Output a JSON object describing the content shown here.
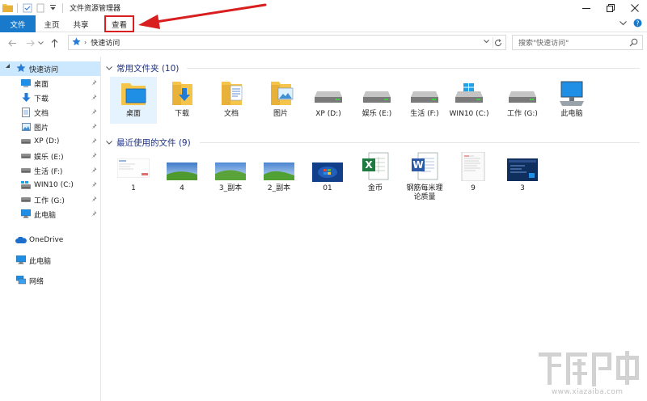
{
  "window": {
    "title": "文件资源管理器"
  },
  "ribbon": {
    "tabs": [
      {
        "label": "文件"
      },
      {
        "label": "主页"
      },
      {
        "label": "共享"
      },
      {
        "label": "查看"
      }
    ]
  },
  "address": {
    "location": "快速访问",
    "search_placeholder": "搜索\"快速访问\""
  },
  "sidebar": {
    "quick_access": "快速访问",
    "items": [
      {
        "label": "桌面",
        "icon": "desktop-icon",
        "pinned": true
      },
      {
        "label": "下载",
        "icon": "download-icon",
        "pinned": true
      },
      {
        "label": "文档",
        "icon": "document-icon",
        "pinned": true
      },
      {
        "label": "图片",
        "icon": "picture-icon",
        "pinned": true
      },
      {
        "label": "XP (D:)",
        "icon": "drive-icon",
        "pinned": true
      },
      {
        "label": "娱乐 (E:)",
        "icon": "drive-icon",
        "pinned": true
      },
      {
        "label": "生活 (F:)",
        "icon": "drive-icon",
        "pinned": true
      },
      {
        "label": "WIN10 (C:)",
        "icon": "windows-drive-icon",
        "pinned": true
      },
      {
        "label": "工作 (G:)",
        "icon": "drive-icon",
        "pinned": true
      },
      {
        "label": "此电脑",
        "icon": "computer-icon",
        "pinned": true
      }
    ],
    "onedrive": "OneDrive",
    "this_pc": "此电脑",
    "network": "网络"
  },
  "frequent": {
    "header": "常用文件夹 (10)",
    "items": [
      {
        "label": "桌面"
      },
      {
        "label": "下载"
      },
      {
        "label": "文档"
      },
      {
        "label": "图片"
      },
      {
        "label": "XP (D:)"
      },
      {
        "label": "娱乐 (E:)"
      },
      {
        "label": "生活 (F:)"
      },
      {
        "label": "WIN10 (C:)"
      },
      {
        "label": "工作 (G:)"
      },
      {
        "label": "此电脑"
      }
    ]
  },
  "recent": {
    "header": "最近使用的文件 (9)",
    "items": [
      {
        "label": "1"
      },
      {
        "label": "4"
      },
      {
        "label": "3_副本"
      },
      {
        "label": "2_副本"
      },
      {
        "label": "01"
      },
      {
        "label": "金币"
      },
      {
        "label": "钢筋每米理论质量"
      },
      {
        "label": "9"
      },
      {
        "label": "3"
      }
    ]
  },
  "watermark": {
    "url": "www.xiazaiba.com"
  },
  "colors": {
    "accent": "#1979ca",
    "selection": "#cce8ff",
    "annotation": "#d81e1e",
    "group_header": "#1e3287"
  }
}
